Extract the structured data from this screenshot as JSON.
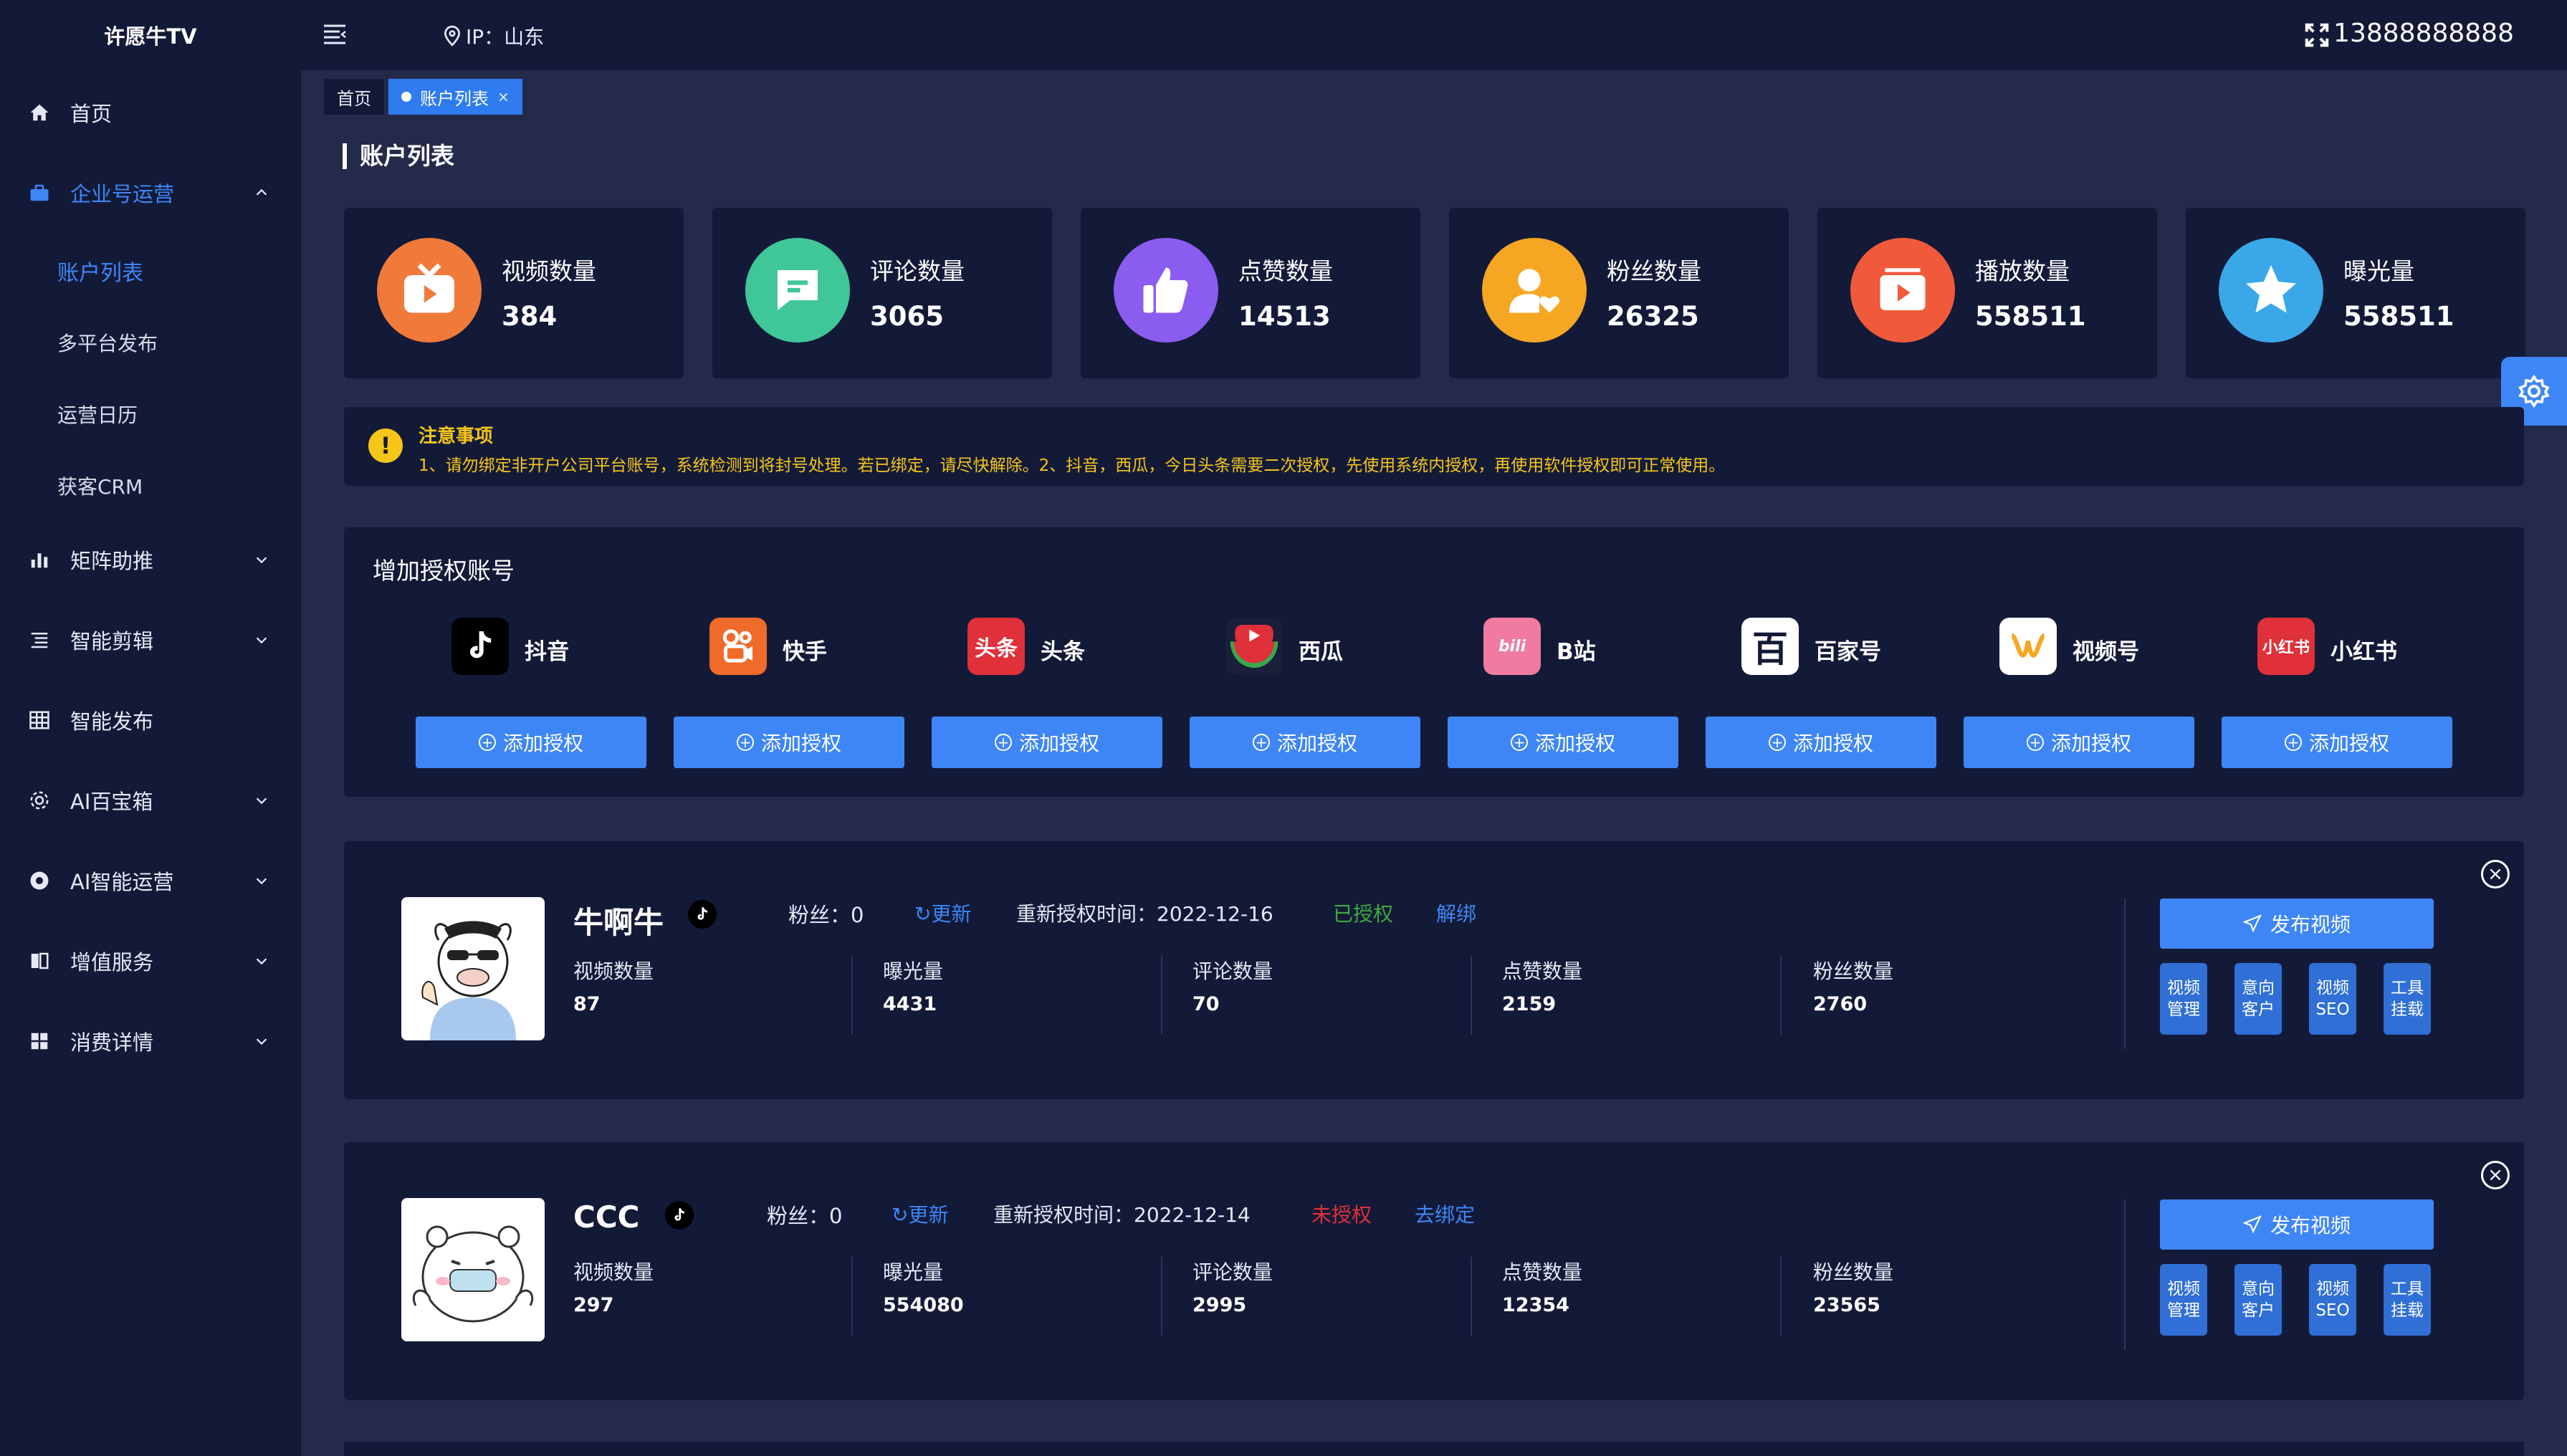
{
  "app": {
    "brand": "许愿牛TV"
  },
  "topbar": {
    "ip_label": "IP：山东",
    "phone": "13888888888"
  },
  "sidebar": {
    "items": [
      {
        "label": "首页",
        "icon": "home-icon"
      },
      {
        "label": "企业号运营",
        "icon": "briefcase-icon",
        "expanded": true
      },
      {
        "label": "矩阵助推",
        "icon": "bar-chart-icon"
      },
      {
        "label": "智能剪辑",
        "icon": "list-icon"
      },
      {
        "label": "智能发布",
        "icon": "grid-icon"
      },
      {
        "label": "AI百宝箱",
        "icon": "gear-icon"
      },
      {
        "label": "AI智能运营",
        "icon": "aperture-icon"
      },
      {
        "label": "增值服务",
        "icon": "book-icon"
      },
      {
        "label": "消费详情",
        "icon": "apps-icon"
      }
    ],
    "sub_items": [
      "账户列表",
      "多平台发布",
      "运营日历",
      "获客CRM"
    ]
  },
  "tabs": [
    {
      "label": "首页"
    },
    {
      "label": "账户列表",
      "close": "×"
    }
  ],
  "page_title": "账户列表",
  "stats": [
    {
      "label": "视频数量",
      "value": "384",
      "color": "#f07a3a"
    },
    {
      "label": "评论数量",
      "value": "3065",
      "color": "#3fc79a"
    },
    {
      "label": "点赞数量",
      "value": "14513",
      "color": "#8a5cf0"
    },
    {
      "label": "粉丝数量",
      "value": "26325",
      "color": "#f5a623"
    },
    {
      "label": "播放数量",
      "value": "558511",
      "color": "#f05a3a"
    },
    {
      "label": "曝光量",
      "value": "558511",
      "color": "#3aa8e8"
    }
  ],
  "notice": {
    "icon": "!",
    "title": "注意事项",
    "text": "1、请勿绑定非开户公司平台账号，系统检测到将封号处理。若已绑定，请尽快解除。2、抖音，西瓜，今日头条需要二次授权，先使用系统内授权，再使用软件授权即可正常使用。"
  },
  "auth": {
    "title": "增加授权账号",
    "button_label": "添加授权",
    "platforms": [
      {
        "name": "抖音",
        "logo_text": "♪",
        "color": "#000000"
      },
      {
        "name": "快手",
        "logo_text": "快",
        "color": "#f06a2a"
      },
      {
        "name": "头条",
        "logo_text": "头条",
        "color": "#e0303a"
      },
      {
        "name": "西瓜",
        "logo_text": "▶",
        "color": "#e0303a"
      },
      {
        "name": "B站",
        "logo_text": "bili",
        "color": "#f07aa0"
      },
      {
        "name": "百家号",
        "logo_text": "百",
        "color": "#ffffff"
      },
      {
        "name": "视频号",
        "logo_text": "∞",
        "color": "#ffffff"
      },
      {
        "name": "小红书",
        "logo_text": "小红书",
        "color": "#e0303a"
      }
    ]
  },
  "accounts": [
    {
      "name": "牛啊牛",
      "fans": "粉丝：0",
      "refresh": "更新",
      "reauth": "重新授权时间：2022-12-16",
      "status": "已授权",
      "status_color": "#3eaa3e",
      "action": "解绑",
      "metrics": [
        {
          "label": "视频数量",
          "value": "87"
        },
        {
          "label": "曝光量",
          "value": "4431"
        },
        {
          "label": "评论数量",
          "value": "70"
        },
        {
          "label": "点赞数量",
          "value": "2159"
        },
        {
          "label": "粉丝数量",
          "value": "2760"
        }
      ]
    },
    {
      "name": "CCC",
      "fans": "粉丝：0",
      "refresh": "更新",
      "reauth": "重新授权时间：2022-12-14",
      "status": "未授权",
      "status_color": "#e0303a",
      "action": "去绑定",
      "metrics": [
        {
          "label": "视频数量",
          "value": "297"
        },
        {
          "label": "曝光量",
          "value": "554080"
        },
        {
          "label": "评论数量",
          "value": "2995"
        },
        {
          "label": "点赞数量",
          "value": "12354"
        },
        {
          "label": "粉丝数量",
          "value": "23565"
        }
      ]
    }
  ],
  "account_actions": {
    "publish": "发布视频",
    "buttons": [
      "视频管理",
      "意向客户",
      "视频SEO",
      "工具挂载"
    ]
  },
  "colors": {
    "accent": "#3e86f5",
    "bg": "#232a4a",
    "panel": "#131a38",
    "warning": "#f5c518"
  }
}
